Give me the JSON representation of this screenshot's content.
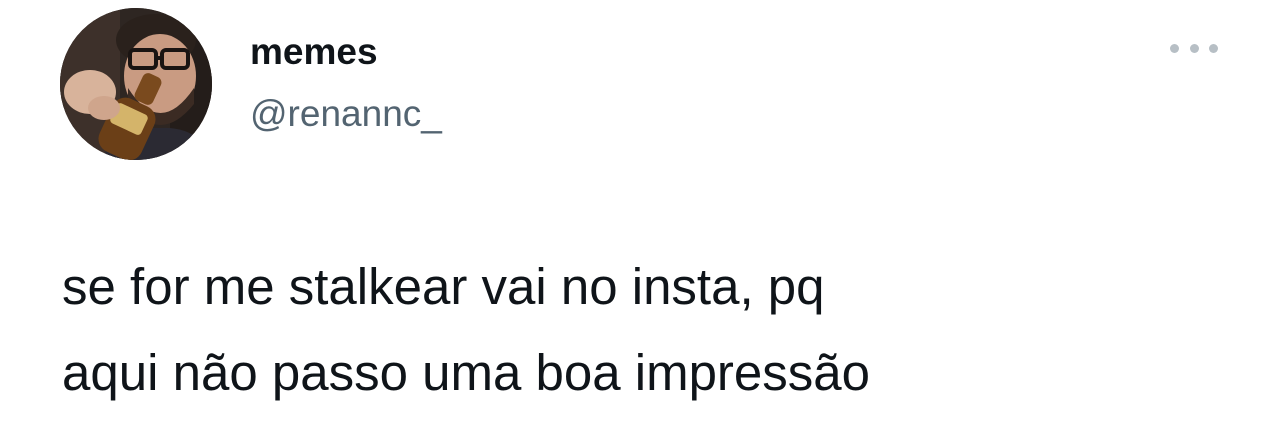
{
  "tweet": {
    "author": {
      "display_name": "memes",
      "handle": "@renannc_",
      "avatar_icon": "profile-photo"
    },
    "menu_icon": "more-options-icon",
    "text": "se for me stalkear vai no insta, pq\naqui não passo uma boa impressão"
  },
  "colors": {
    "text": "#0f1419",
    "secondary_text": "#536471",
    "menu_dots": "#b7bfc5",
    "background": "#ffffff"
  }
}
